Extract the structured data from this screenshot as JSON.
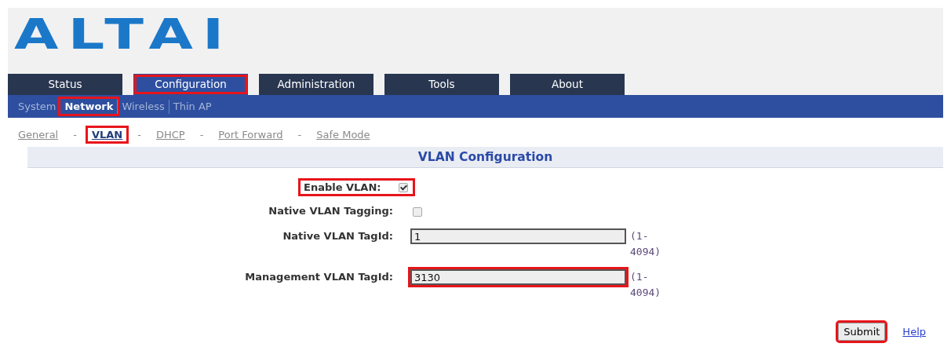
{
  "logo": "ALTAI",
  "tabs": [
    {
      "label": "Status",
      "selected": false,
      "highlighted": false
    },
    {
      "label": "Configuration",
      "selected": true,
      "highlighted": true
    },
    {
      "label": "Administration",
      "selected": false,
      "highlighted": false
    },
    {
      "label": "Tools",
      "selected": false,
      "highlighted": false
    },
    {
      "label": "About",
      "selected": false,
      "highlighted": false
    }
  ],
  "subtabs": [
    {
      "label": "System",
      "selected": false,
      "highlighted": false
    },
    {
      "label": "Network",
      "selected": true,
      "highlighted": true
    },
    {
      "label": "Wireless",
      "selected": false,
      "highlighted": false
    },
    {
      "label": "Thin AP",
      "selected": false,
      "highlighted": false
    }
  ],
  "page_links": [
    {
      "label": "General",
      "selected": false,
      "highlighted": false
    },
    {
      "label": "VLAN",
      "selected": true,
      "highlighted": true
    },
    {
      "label": "DHCP",
      "selected": false,
      "highlighted": false
    },
    {
      "label": "Port Forward",
      "selected": false,
      "highlighted": false
    },
    {
      "label": "Safe Mode",
      "selected": false,
      "highlighted": false
    }
  ],
  "link_separator": "-",
  "section_title": "VLAN Configuration",
  "fields": [
    {
      "kind": "checkbox",
      "label": "Enable VLAN:",
      "checked": true,
      "highlighted": true
    },
    {
      "kind": "checkbox",
      "label": "Native VLAN Tagging:",
      "checked": false,
      "highlighted": false
    },
    {
      "kind": "text",
      "label": "Native VLAN TagId:",
      "value": "1",
      "range": "(1-4094)",
      "highlighted": false
    },
    {
      "kind": "text",
      "label": "Management VLAN TagId:",
      "value": "3130",
      "range": "(1-4094)",
      "highlighted": true
    }
  ],
  "submit": {
    "label": "Submit",
    "highlighted": true
  },
  "help": "Help"
}
